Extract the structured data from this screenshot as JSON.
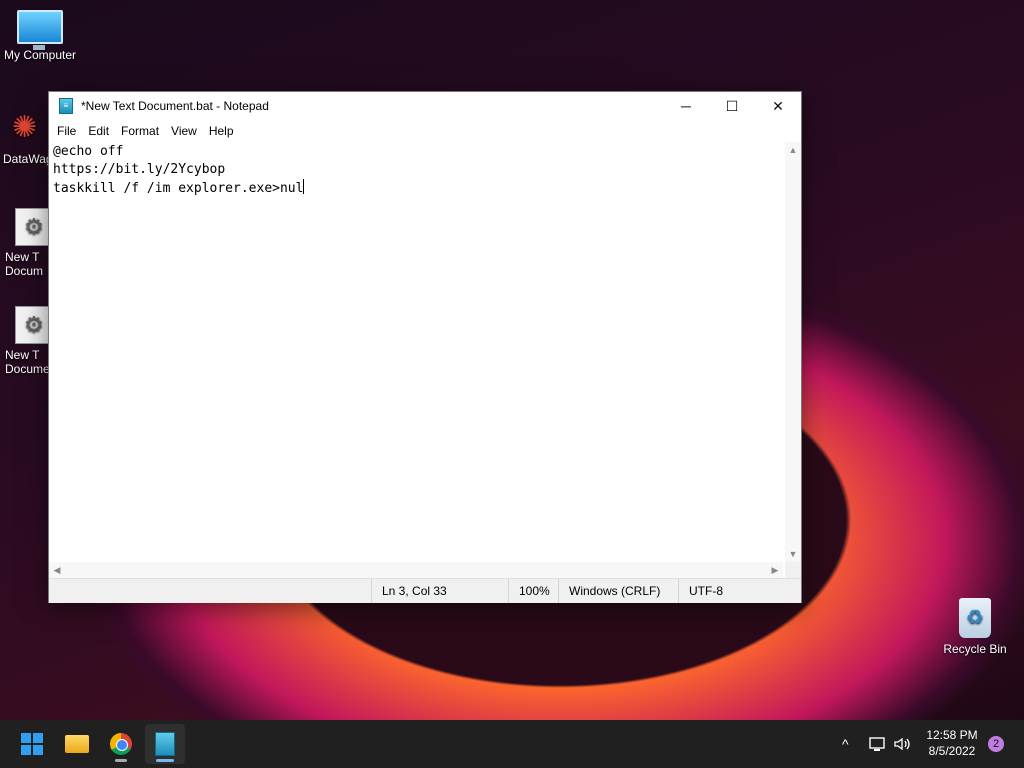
{
  "desktop": {
    "icons": [
      {
        "label": "My Computer"
      },
      {
        "label": "DataWag"
      },
      {
        "label": "New T\nDocum"
      },
      {
        "label": "New T\nDocume"
      },
      {
        "label": "Recycle Bin"
      }
    ]
  },
  "window": {
    "title": "*New Text Document.bat - Notepad",
    "controls": {
      "minimize": "─",
      "maximize": "☐",
      "close": "✕"
    },
    "menu": [
      "File",
      "Edit",
      "Format",
      "View",
      "Help"
    ],
    "content_lines": [
      "@echo off",
      "https://bit.ly/2Ycybop",
      "taskkill /f /im explorer.exe>nul"
    ],
    "status": {
      "position": "Ln 3, Col 33",
      "zoom": "100%",
      "line_ending": "Windows (CRLF)",
      "encoding": "UTF-8"
    }
  },
  "taskbar": {
    "apps": [
      {
        "icon": "windows-start-icon"
      },
      {
        "icon": "file-explorer-icon"
      },
      {
        "icon": "chrome-icon"
      },
      {
        "icon": "notepad-icon",
        "active": true
      }
    ],
    "tray": {
      "chevron": "^",
      "time": "12:58 PM",
      "date": "8/5/2022",
      "notifications": "2"
    }
  },
  "colors": {
    "accent": "#76b9ed",
    "notification_badge": "#c07fe0"
  }
}
